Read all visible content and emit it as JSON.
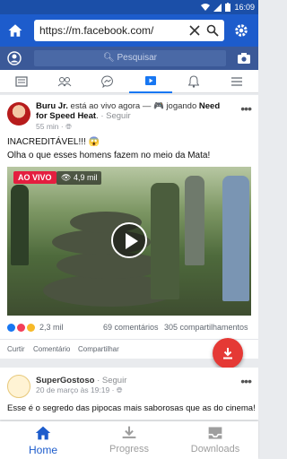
{
  "status": {
    "time": "16:09"
  },
  "browser": {
    "url": "https://m.facebook.com/"
  },
  "fb": {
    "search_placeholder": "Pesquisar",
    "tabs": [
      "news-feed",
      "friends",
      "messenger",
      "watch",
      "notifications",
      "menu"
    ],
    "active_tab": "watch"
  },
  "post1": {
    "author": "Buru Jr.",
    "action": "está ao vivo agora — 🎮 jogando",
    "game": "Need for Speed Heat",
    "follow": "Seguir",
    "time": "55 min",
    "text1": "INACREDITÁVEL!!! 😱",
    "text2": "Olha o que esses homens fazem no meio da Mata!",
    "live_badge": "AO VIVO",
    "views": "4,9 mil",
    "reactions": "2,3 mil",
    "comments": "69 comentários",
    "shares": "305 compartilhamentos",
    "actions": {
      "like": "Curtir",
      "comment": "Comentário",
      "share": "Compartilhar"
    }
  },
  "post2": {
    "author": "SuperGostoso",
    "follow": "Seguir",
    "time": "20 de março às 19:19",
    "text": "Esse é o segredo das pipocas mais saborosas que as do cinema!"
  },
  "bottom_nav": [
    {
      "label": "Home",
      "icon": "home-icon",
      "color": "#1d5ccc"
    },
    {
      "label": "Progress",
      "icon": "download-tray-icon",
      "color": "#9e9e9e"
    },
    {
      "label": "Downloads",
      "icon": "inbox-icon",
      "color": "#9e9e9e"
    }
  ],
  "colors": {
    "statusbar": "#1b4fa8",
    "toolbar": "#1d5ccc",
    "fb_bar": "#3b5998",
    "fab": "#e53935",
    "live": "#e41e3f"
  }
}
